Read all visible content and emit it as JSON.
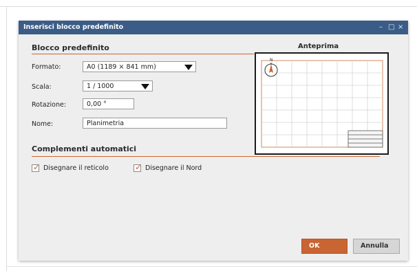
{
  "dialog": {
    "title": "Inserisci blocco predefinito",
    "window_controls": {
      "minimize": "–",
      "maximize": "□",
      "close": "×"
    }
  },
  "block_section": {
    "title": "Blocco predefinito",
    "format_label": "Formato:",
    "format_value": "A0  (1189 × 841 mm)",
    "scale_label": "Scala:",
    "scale_value": "1 / 1000",
    "rotation_label": "Rotazione:",
    "rotation_value": "0,00 °",
    "name_label": "Nome:",
    "name_value": "Planimetria"
  },
  "preview": {
    "title": "Anteprima",
    "north_letter": "N"
  },
  "auto_section": {
    "title": "Complementi automatici",
    "grid_checkbox": {
      "label": "Disegnare il reticolo",
      "checked": true
    },
    "north_checkbox": {
      "label": "Disegnare il Nord",
      "checked": true
    }
  },
  "buttons": {
    "ok": "OK",
    "cancel": "Annulla"
  },
  "colors": {
    "accent": "#c96433",
    "titlebar": "#3b5c86",
    "dialog_bg": "#eeeeee"
  }
}
